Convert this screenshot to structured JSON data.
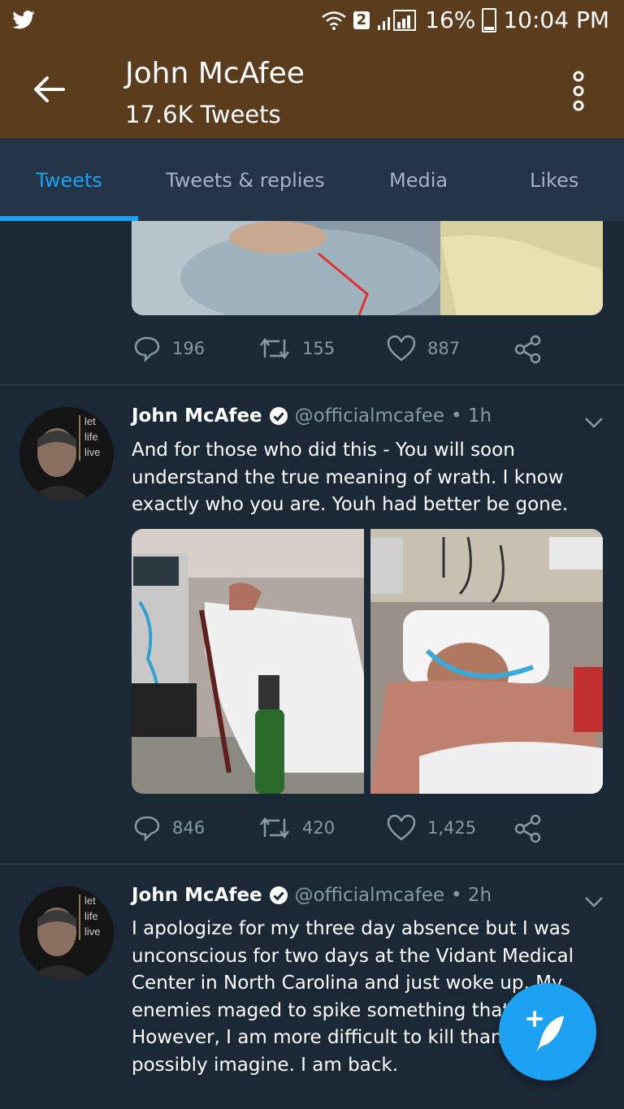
{
  "status_bar": {
    "sim_badge": "2",
    "battery": "16%",
    "time": "10:04 PM",
    "icons": [
      "twitter-bird-icon",
      "wifi-icon",
      "signal-icon",
      "battery-icon"
    ]
  },
  "app_bar": {
    "title": "John McAfee",
    "subtitle": "17.6K Tweets"
  },
  "tabs": [
    {
      "label": "Tweets",
      "active": true
    },
    {
      "label": "Tweets & replies",
      "active": false
    },
    {
      "label": "Media",
      "active": false
    },
    {
      "label": "Likes",
      "active": false
    }
  ],
  "tweets": [
    {
      "replies": "196",
      "retweets": "155",
      "likes": "887"
    },
    {
      "name": "John McAfee",
      "handle": "@officialmcafee",
      "time": "• 1h",
      "avatar_text": [
        "let",
        "life",
        "live"
      ],
      "text": "And for those who did this - You will soon understand the true meaning of wrath. I know exactly who you  are. Youh had better be gone.",
      "replies": "846",
      "retweets": "420",
      "likes": "1,425"
    },
    {
      "name": "John McAfee",
      "handle": "@officialmcafee",
      "time": "• 2h",
      "avatar_text": [
        "let",
        "life",
        "live"
      ],
      "text": "I apologize for my three day absence but I was unconscious for two days at the Vidant Medical Center in North Carolina and just woke up. My enemies maged to spike something that i ate. However, I am more difficult to kill than you can possibly imagine. I am back."
    }
  ],
  "colors": {
    "header": "#5b3d1e",
    "background": "#1b2836",
    "tabs": "#243447",
    "accent": "#1da1f2",
    "muted": "#8899a6"
  }
}
